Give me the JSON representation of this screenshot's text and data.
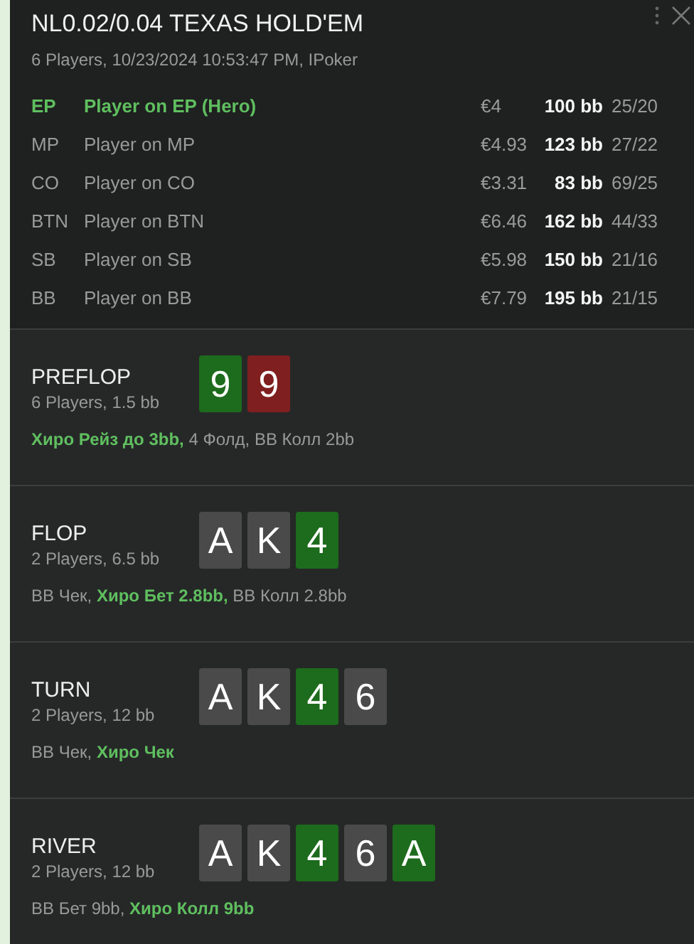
{
  "header": {
    "title": "NL0.02/0.04 TEXAS HOLD'EM",
    "subtitle": "6 Players, 10/23/2024 10:53:47 PM, IPoker"
  },
  "players": [
    {
      "position": "EP",
      "name": "Player on EP (Hero)",
      "hero": true,
      "money": "€4",
      "stack": "100 bb",
      "stats": "25/20"
    },
    {
      "position": "MP",
      "name": "Player on MP",
      "hero": false,
      "money": "€4.93",
      "stack": "123 bb",
      "stats": "27/22"
    },
    {
      "position": "CO",
      "name": "Player on CO",
      "hero": false,
      "money": "€3.31",
      "stack": "83 bb",
      "stats": "69/25"
    },
    {
      "position": "BTN",
      "name": "Player on BTN",
      "hero": false,
      "money": "€6.46",
      "stack": "162 bb",
      "stats": "44/33"
    },
    {
      "position": "SB",
      "name": "Player on SB",
      "hero": false,
      "money": "€5.98",
      "stack": "150 bb",
      "stats": "21/16"
    },
    {
      "position": "BB",
      "name": "Player on BB",
      "hero": false,
      "money": "€7.79",
      "stack": "195 bb",
      "stats": "21/15"
    }
  ],
  "streets": [
    {
      "name": "PREFLOP",
      "info": "6 Players, 1.5 bb",
      "cards": [
        {
          "rank": "9",
          "color": "#1d6b1d"
        },
        {
          "rank": "9",
          "color": "#7f1f1f"
        }
      ],
      "actions": "**Хиро Рейз до 3bb,** 4 Фолд, BB Колл 2bb"
    },
    {
      "name": "FLOP",
      "info": "2 Players, 6.5 bb",
      "cards": [
        {
          "rank": "A",
          "color": "#4a4a4a"
        },
        {
          "rank": "K",
          "color": "#4a4a4a"
        },
        {
          "rank": "4",
          "color": "#1d6b1d"
        }
      ],
      "actions": "BB Чек, **Хиро Бет 2.8bb,** BB Колл 2.8bb"
    },
    {
      "name": "TURN",
      "info": "2 Players, 12 bb",
      "cards": [
        {
          "rank": "A",
          "color": "#4a4a4a"
        },
        {
          "rank": "K",
          "color": "#4a4a4a"
        },
        {
          "rank": "4",
          "color": "#1d6b1d"
        },
        {
          "rank": "6",
          "color": "#4a4a4a"
        }
      ],
      "actions": "BB Чек, **Хиро Чек**"
    },
    {
      "name": "RIVER",
      "info": "2 Players, 12 bb",
      "cards": [
        {
          "rank": "A",
          "color": "#4a4a4a"
        },
        {
          "rank": "K",
          "color": "#4a4a4a"
        },
        {
          "rank": "4",
          "color": "#1d6b1d"
        },
        {
          "rank": "6",
          "color": "#4a4a4a"
        },
        {
          "rank": "A",
          "color": "#1d6b1d"
        }
      ],
      "actions": "BB Бет 9bb, **Хиро Колл 9bb**"
    }
  ]
}
